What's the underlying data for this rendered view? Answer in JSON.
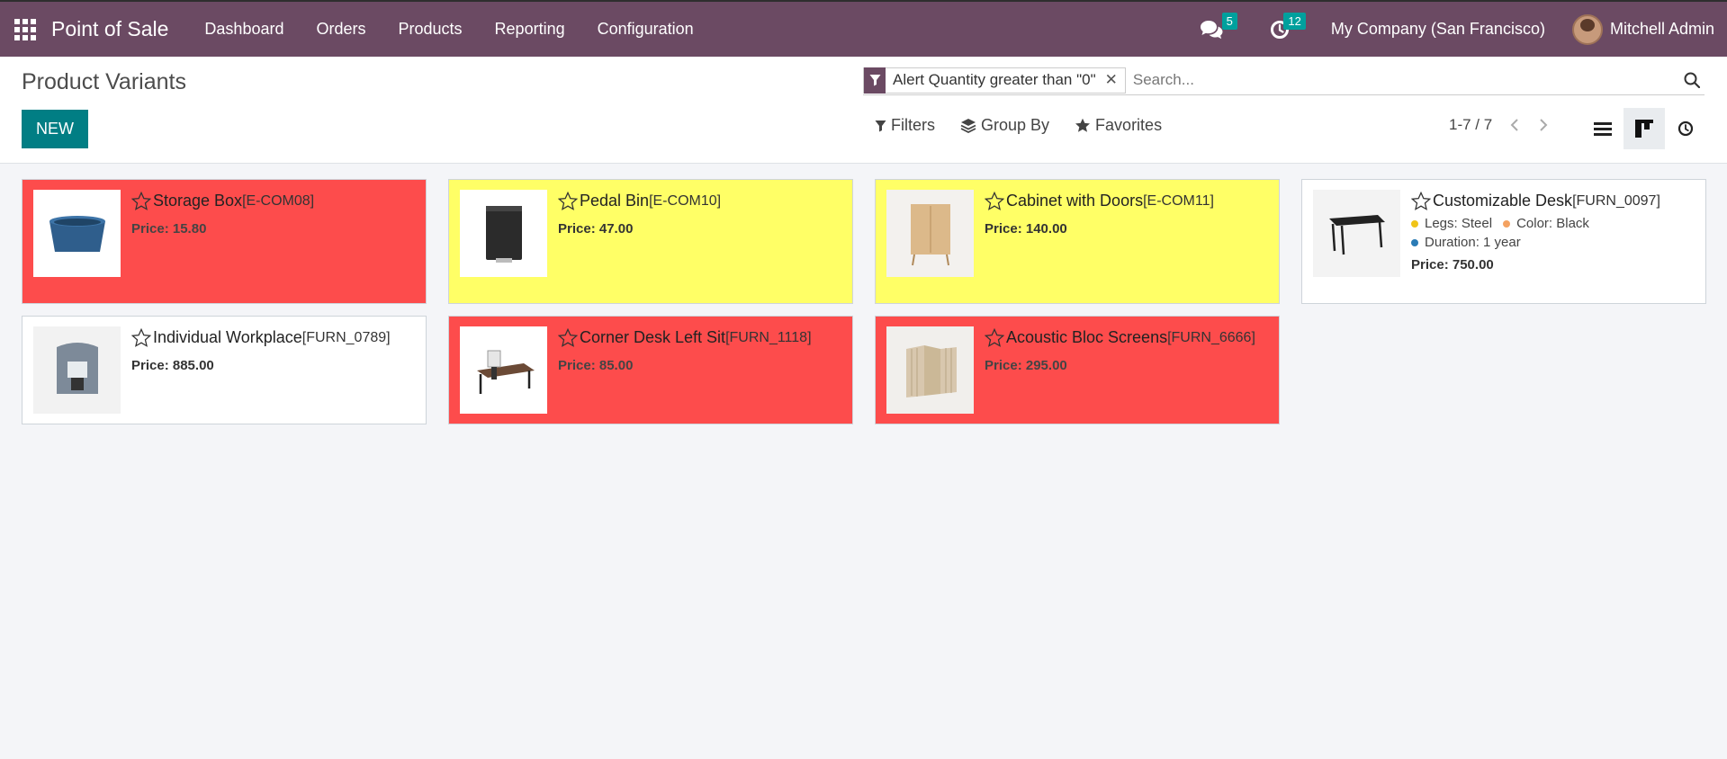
{
  "navbar": {
    "brand": "Point of Sale",
    "menu": [
      "Dashboard",
      "Orders",
      "Products",
      "Reporting",
      "Configuration"
    ],
    "messages_count": "5",
    "activities_count": "12",
    "company": "My Company (San Francisco)",
    "user": "Mitchell Admin",
    "bg_color": "#6b4a63"
  },
  "control_panel": {
    "title": "Product Variants",
    "new_label": "NEW",
    "facet": "Alert Quantity greater than \"0\"",
    "search_placeholder": "Search...",
    "filters_label": "Filters",
    "group_by_label": "Group By",
    "favorites_label": "Favorites",
    "pager": "1-7 / 7",
    "accent_color": "#017e84"
  },
  "cards": [
    {
      "name": "Storage Box",
      "ref": "[E-COM08]",
      "price_label": "Price:",
      "price": "15.80",
      "color": "red"
    },
    {
      "name": "Pedal Bin",
      "ref": "[E-COM10]",
      "price_label": "Price:",
      "price": "47.00",
      "color": "yellow"
    },
    {
      "name": "Cabinet with Doors",
      "ref": "[E-COM11]",
      "price_label": "Price:",
      "price": "140.00",
      "color": "yellow"
    },
    {
      "name": "Customizable Desk",
      "ref": "[FURN_0097]",
      "price_label": "Price:",
      "price": "750.00",
      "color": "white",
      "attrs": {
        "legs": "Legs: Steel",
        "color": "Color: Black",
        "duration": "Duration: 1 year"
      }
    },
    {
      "name": "Individual Workplace",
      "ref": "[FURN_0789]",
      "price_label": "Price:",
      "price": "885.00",
      "color": "white"
    },
    {
      "name": "Corner Desk Left Sit",
      "ref": "[FURN_1118]",
      "price_label": "Price:",
      "price": "85.00",
      "color": "red"
    },
    {
      "name": "Acoustic Bloc Screens",
      "ref": "[FURN_6666]",
      "price_label": "Price:",
      "price": "295.00",
      "color": "red"
    }
  ]
}
